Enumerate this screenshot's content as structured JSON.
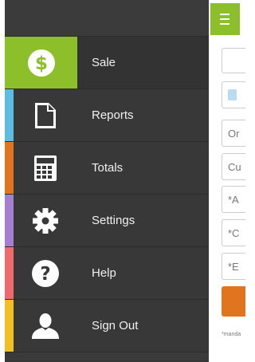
{
  "content": {
    "fields": [
      {
        "text": ""
      },
      {
        "text": ""
      },
      {
        "text": "Or"
      },
      {
        "text": "Cu"
      },
      {
        "text": "*A"
      },
      {
        "text": "*C"
      },
      {
        "text": "*E"
      }
    ],
    "note": "*manda"
  },
  "menu": {
    "items": [
      {
        "label": "Sale",
        "icon": "dollar-icon",
        "color": "#8dbf2a"
      },
      {
        "label": "Reports",
        "icon": "document-icon",
        "color": "#5bbde1"
      },
      {
        "label": "Totals",
        "icon": "calculator-icon",
        "color": "#e0741f"
      },
      {
        "label": "Settings",
        "icon": "gear-icon",
        "color": "#a47fcf"
      },
      {
        "label": "Help",
        "icon": "question-icon",
        "color": "#ee6a6c"
      },
      {
        "label": "Sign Out",
        "icon": "user-icon",
        "color": "#f0bf22"
      }
    ]
  },
  "colors": {
    "accent": "#8dbf2a",
    "drawer_bg": "#383838",
    "submit": "#e0741f"
  }
}
